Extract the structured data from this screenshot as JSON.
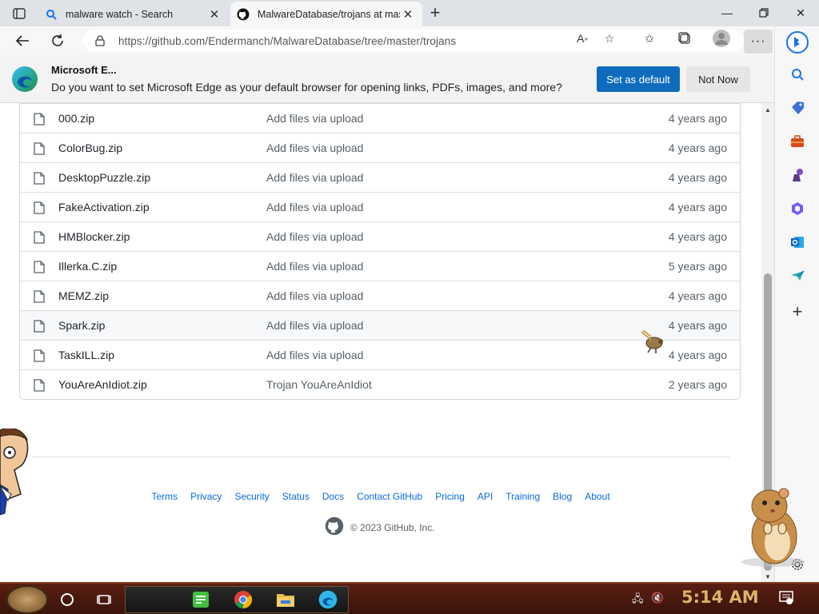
{
  "browser": {
    "tabs": [
      {
        "title": "malware watch - Search",
        "favicon": "search-icon"
      },
      {
        "title": "MalwareDatabase/trojans at mas",
        "favicon": "github-icon"
      }
    ],
    "url": "https://github.com/Endermanch/MalwareDatabase/tree/master/trojans"
  },
  "infobar": {
    "title": "Microsoft E...",
    "message": "Do you want to set Microsoft Edge as your default browser for opening links, PDFs, images, and more?",
    "primary_button": "Set as default",
    "secondary_button": "Not Now"
  },
  "files": [
    {
      "name": "000.zip",
      "message": "Add files via upload",
      "age": "4 years ago"
    },
    {
      "name": "ColorBug.zip",
      "message": "Add files via upload",
      "age": "4 years ago"
    },
    {
      "name": "DesktopPuzzle.zip",
      "message": "Add files via upload",
      "age": "4 years ago"
    },
    {
      "name": "FakeActivation.zip",
      "message": "Add files via upload",
      "age": "4 years ago"
    },
    {
      "name": "HMBlocker.zip",
      "message": "Add files via upload",
      "age": "4 years ago"
    },
    {
      "name": "Illerka.C.zip",
      "message": "Add files via upload",
      "age": "5 years ago"
    },
    {
      "name": "MEMZ.zip",
      "message": "Add files via upload",
      "age": "4 years ago"
    },
    {
      "name": "Spark.zip",
      "message": "Add files via upload",
      "age": "4 years ago"
    },
    {
      "name": "TaskILL.zip",
      "message": "Add files via upload",
      "age": "4 years ago"
    },
    {
      "name": "YouAreAnIdiot.zip",
      "message": "Trojan YouAreAnIdiot",
      "age": "2 years ago"
    }
  ],
  "footer": {
    "links": [
      "Terms",
      "Privacy",
      "Security",
      "Status",
      "Docs",
      "Contact GitHub",
      "Pricing",
      "API",
      "Training",
      "Blog",
      "About"
    ],
    "copyright": "© 2023 GitHub, Inc."
  },
  "taskbar": {
    "clock": "5:14 AM"
  },
  "colors": {
    "accent": "#0f6cbd",
    "link": "#0969da",
    "clock": "#d9b46a"
  }
}
